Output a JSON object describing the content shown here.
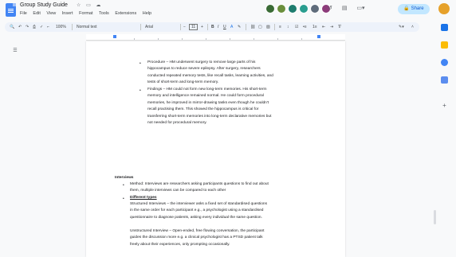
{
  "header": {
    "title": "Group Study Guide",
    "title_icons": [
      "star-icon",
      "folder-icon",
      "cloud-icon"
    ],
    "menu": [
      "File",
      "Edit",
      "View",
      "Insert",
      "Format",
      "Tools",
      "Extensions",
      "Help"
    ],
    "share_label": "Share"
  },
  "toolbar": {
    "zoom": "100%",
    "style": "Normal text",
    "font": "Arial",
    "font_size": "11"
  },
  "document": {
    "bullets_top": [
      {
        "lines": [
          "Procedure – HM underwent surgery to remove large parts of his",
          "hippocampus to reduce severe epilepsy. After surgery, researchers",
          "conducted repeated memory tests, like recall tasks, learning activities, and",
          "tests of short-term and long-term memory."
        ]
      },
      {
        "lines": [
          "Findings – HM could not form new long-term memories. His short-term",
          "memory and intelligence remained normal. He could form procedural",
          "memories, he improved in mirror-drawing tasks even though he couldn't",
          "recall practising them. This showed the hippocampus is critical for",
          "transferring short-term memories into long-term declarative memories but",
          "not needed for procedural memory."
        ]
      }
    ],
    "section_heading": "Interviews",
    "bullet_interviews": [
      "Method: Interviews are researchers asking participants questions to find out about",
      "them, multiple interviews can be compared to each other"
    ],
    "subheading": "Different types",
    "structured": [
      "Structured Interviews – the interviewer asks a fixed set of standardised questions",
      "in the same order for each participant e.g., a psychologist using a standardised",
      "questionnaire to diagnose patients, asking every individual the same question."
    ],
    "unstructured": [
      "Unstructured Interview – Open-ended, free flowing conversation, the participant",
      "guides the discussion more e.g. a clinical psychologist has a PTSD patient talk",
      "freely about their experiences, only prompting occasionally."
    ]
  },
  "colors": {
    "accent": "#4285f4",
    "share_bg": "#c2e7ff",
    "toolbar_bg": "#edf2fa",
    "avatar_colors": [
      "#3a6b35",
      "#6a8f3c",
      "#1e7c6e",
      "#2a9d8f",
      "#5f6c7b",
      "#8c3b7a"
    ]
  }
}
